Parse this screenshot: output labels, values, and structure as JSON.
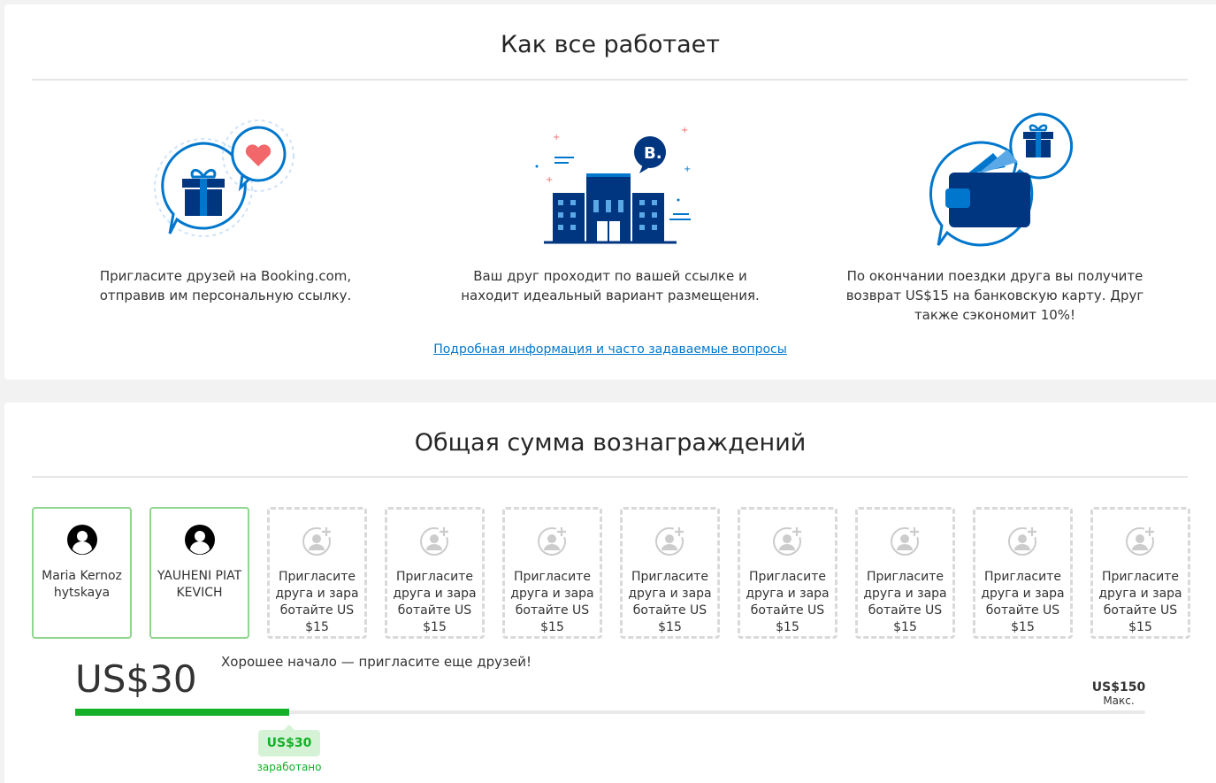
{
  "how_it_works": {
    "title": "Как все работает",
    "steps": [
      {
        "icon": "gift-heart-icon",
        "text": "Пригласите друзей на Booking.com, отправив им персональную ссылку."
      },
      {
        "icon": "hotel-building-icon",
        "text": "Ваш друг проходит по вашей ссылке и находит идеальный вариант размещения."
      },
      {
        "icon": "wallet-gift-icon",
        "text": "По окончании поездки друга вы получите возврат US$15 на банковскую карту. Друг также сэкономит 10%!"
      }
    ],
    "faq_link": "Подробная информация и часто задаваемые вопросы"
  },
  "rewards": {
    "title": "Общая сумма вознаграждений",
    "friends": [
      {
        "name": "Maria Kernozhytskaya",
        "state": "joined"
      },
      {
        "name": "YAUHENI PIATKEVICH",
        "state": "joined"
      }
    ],
    "empty_slot_label": "Пригласите друга и заработайте US$15",
    "empty_slot_count": 8,
    "total": "US$30",
    "encouragement": "Хорошее начало — пригласите еще друзей!",
    "max_amount": "US$150",
    "max_label": "Макс.",
    "progress_fraction": 0.2,
    "earned_amount": "US$30",
    "earned_label": "заработано"
  },
  "colors": {
    "brand_blue": "#003580",
    "accent_blue": "#0077cc",
    "success_green": "#13b028",
    "heart_red": "#f2676a"
  }
}
